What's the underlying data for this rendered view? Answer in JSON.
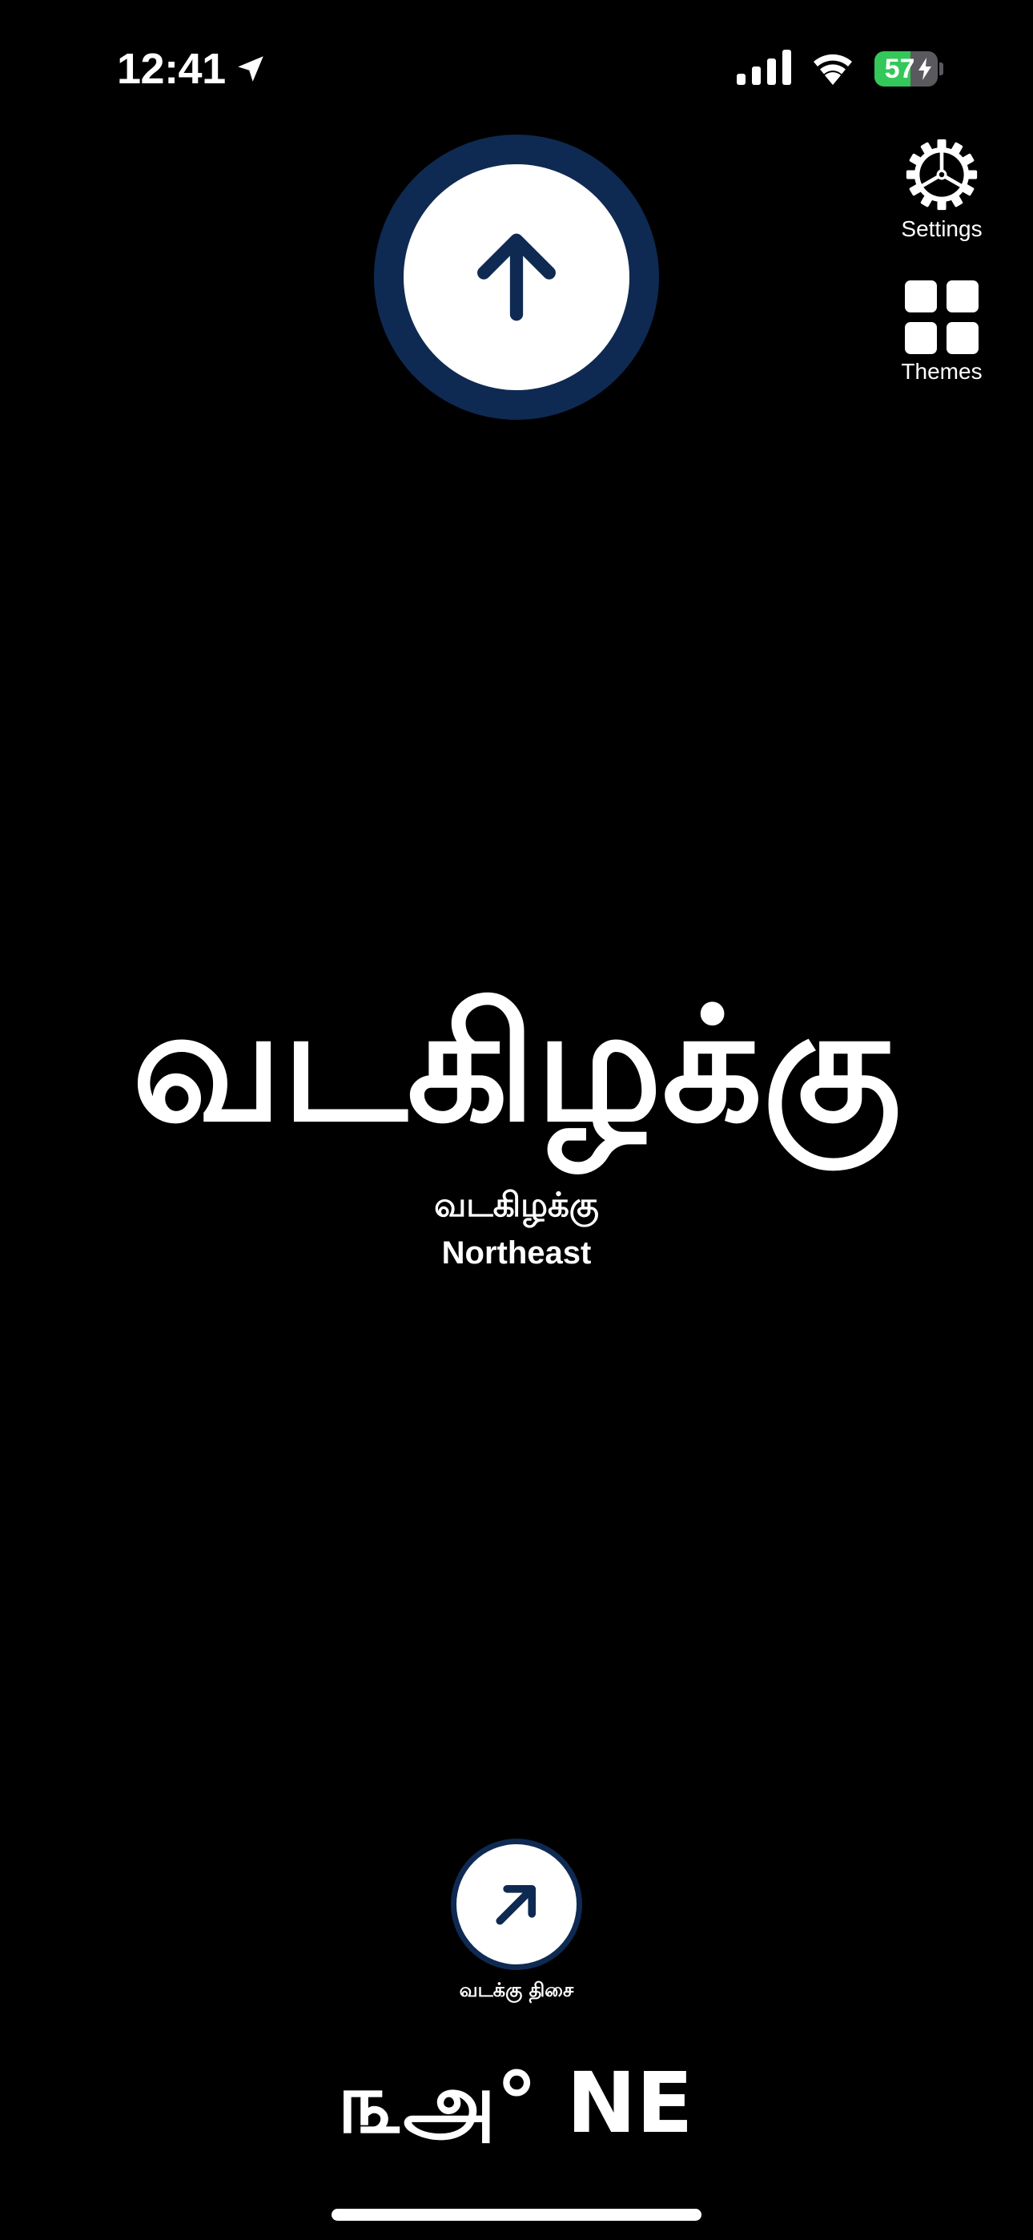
{
  "status_bar": {
    "time": "12:41",
    "location_icon": "location-arrow-icon",
    "signal_icon": "cellular-signal-icon",
    "wifi_icon": "wifi-icon",
    "battery_percent": "57",
    "battery_level": 0.57,
    "battery_charging": true,
    "battery_color": "#34c759"
  },
  "top_indicator": {
    "icon": "arrow-up-icon",
    "ring_color": "#0f2a52",
    "arrow_color": "#0f2a52"
  },
  "side_buttons": {
    "settings": {
      "label": "Settings",
      "icon": "gear-icon"
    },
    "themes": {
      "label": "Themes",
      "icon": "grid-icon"
    }
  },
  "direction": {
    "tamil_large": "வடகிழக்கு",
    "tamil_small": "வடகிழக்கு",
    "english": "Northeast"
  },
  "bottom_indicator": {
    "icon": "arrow-up-right-icon",
    "caption": "வடக்கு திசை"
  },
  "heading": {
    "readout": "௩அ° NE"
  }
}
